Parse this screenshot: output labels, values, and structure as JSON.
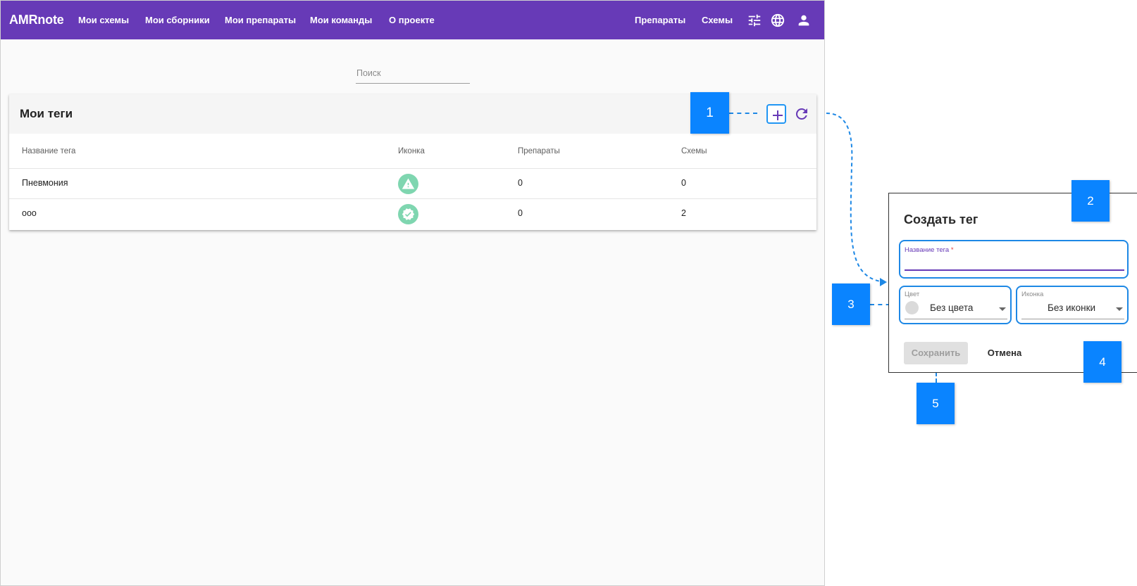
{
  "app": {
    "brand": "AMRnote",
    "nav": [
      "Мои схемы",
      "Мои сборники",
      "Мои препараты",
      "Мои команды",
      "О проекте"
    ],
    "nav_right": [
      "Препараты",
      "Схемы"
    ],
    "icons": [
      "tune-icon",
      "globe-icon",
      "user-icon"
    ]
  },
  "search": {
    "label": "Поиск"
  },
  "tags_card": {
    "title": "Мои теги",
    "columns": [
      "Название тега",
      "Иконка",
      "Препараты",
      "Схемы"
    ],
    "rows": [
      {
        "name": "Пневмония",
        "icon": "warning-icon",
        "preparations": "0",
        "schemes": "0"
      },
      {
        "name": "ооо",
        "icon": "verified-icon",
        "preparations": "0",
        "schemes": "2"
      }
    ],
    "icon_color": "#7fd6b0"
  },
  "dialog": {
    "title": "Создать тег",
    "name_label": "Название тега",
    "required_mark": "*",
    "color_label": "Цвет",
    "color_value": "Без цвета",
    "icon_label": "Иконка",
    "icon_value": "Без иконки",
    "save_label": "Сохранить",
    "cancel_label": "Отмена"
  },
  "callouts": [
    "1",
    "2",
    "3",
    "4",
    "5"
  ],
  "colors": {
    "primary": "#673ab7",
    "annotation": "#0a84ff"
  }
}
